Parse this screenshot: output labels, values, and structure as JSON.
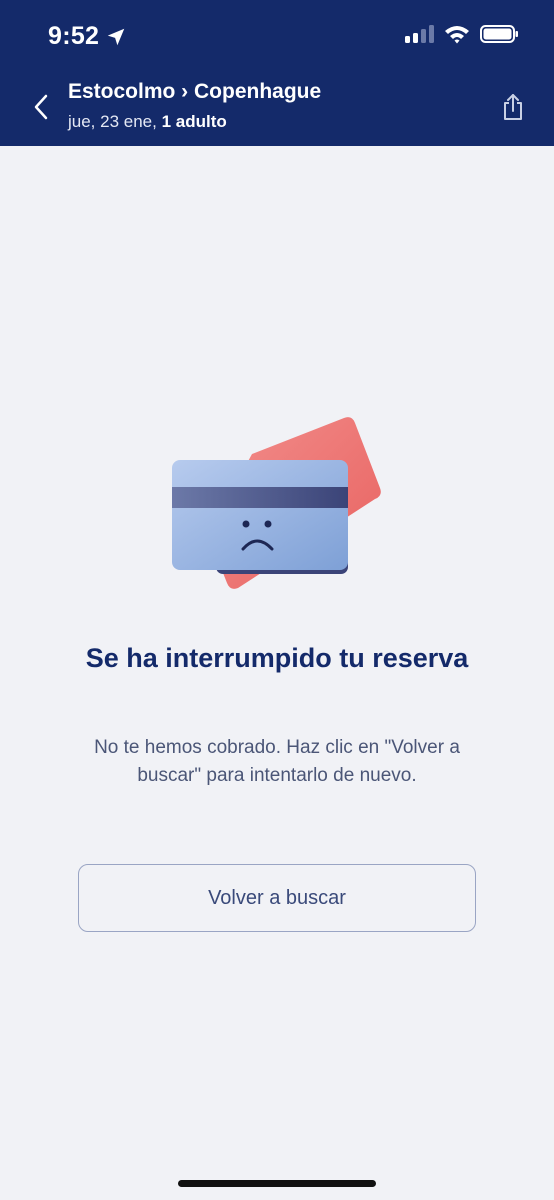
{
  "status_bar": {
    "time": "9:52"
  },
  "header": {
    "route": "Estocolmo › Copenhague",
    "date": "jue, 23 ene",
    "separator": ", ",
    "passengers": "1 adulto"
  },
  "error": {
    "title": "Se ha interrumpido tu reserva",
    "message": "No te hemos cobrado. Haz clic en \"Volver a buscar\" para intentarlo de nuevo.",
    "button_label": "Volver a buscar"
  },
  "icons": {
    "back": "chevron-left-icon",
    "share": "share-icon",
    "illustration": "sad-credit-card-illustration"
  },
  "colors": {
    "header_bg": "#142a6a",
    "title": "#142a6a",
    "background": "#f1f2f6",
    "card_front": "#9fb7e0",
    "card_back": "#ef7a78"
  }
}
